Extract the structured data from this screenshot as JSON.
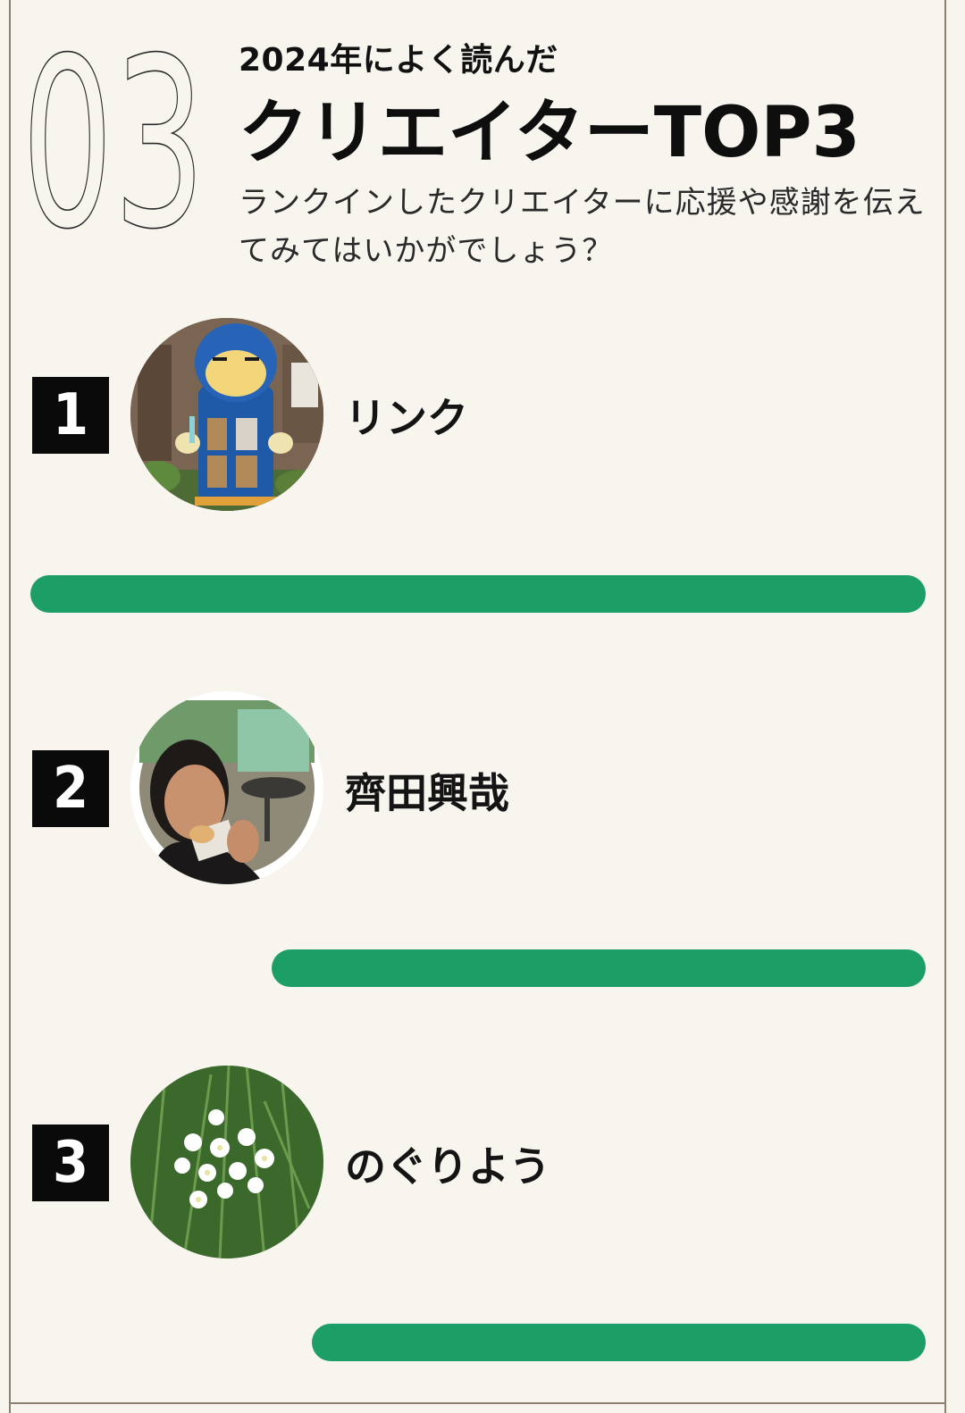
{
  "section": {
    "number": "03",
    "kicker": "2024年によく読んだ",
    "title": "クリエイターTOP3",
    "subtitle": "ランクインしたクリエイターに応援や感謝を伝えてみてはいかがでしょう？"
  },
  "ranking": [
    {
      "rank": "1",
      "name": "リンク",
      "avatar": "blue-mailbox-character-photo"
    },
    {
      "rank": "2",
      "name": "齊田興哉",
      "avatar": "man-eating-photo"
    },
    {
      "rank": "3",
      "name": "のぐりよう",
      "avatar": "white-flowers-photo"
    }
  ],
  "colors": {
    "bar": "#1e9e67",
    "badge": "#0a0a0a",
    "background": "#f8f5ef"
  }
}
